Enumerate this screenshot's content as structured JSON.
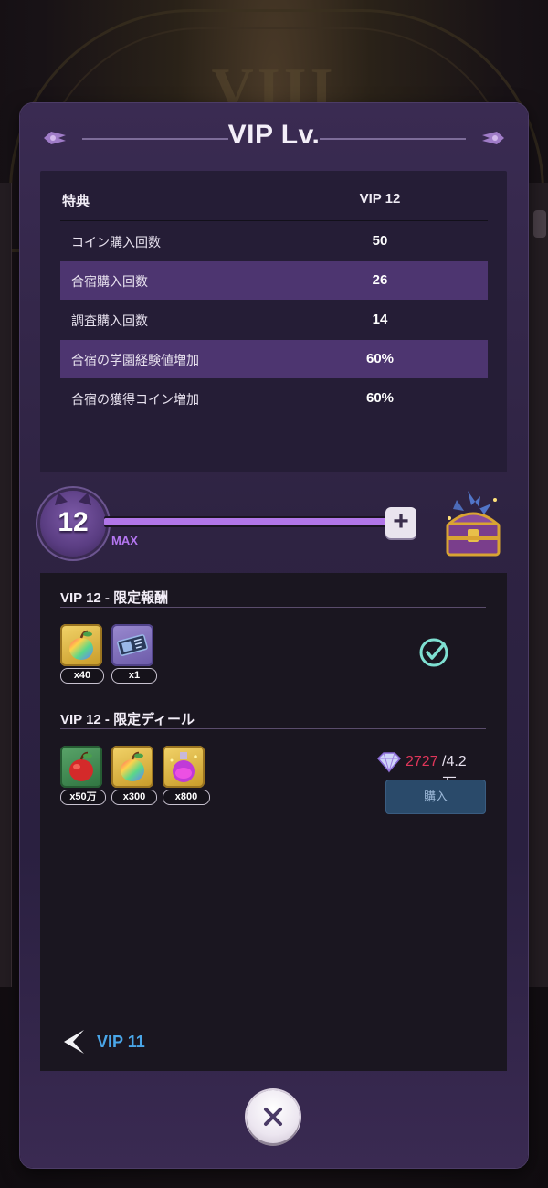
{
  "dialog": {
    "title": "VIP Lv."
  },
  "benefits_table": {
    "header_left": "特典",
    "header_right": "VIP 12",
    "rows": [
      {
        "label": "コイン購入回数",
        "value": "50"
      },
      {
        "label": "合宿購入回数",
        "value": "26"
      },
      {
        "label": "調査購入回数",
        "value": "14"
      },
      {
        "label": "合宿の学園経験値増加",
        "value": "60%"
      },
      {
        "label": "合宿の獲得コイン増加",
        "value": "60%"
      }
    ]
  },
  "level": {
    "current": "12",
    "max_label": "MAX",
    "progress": 1.0,
    "plus_label": "+",
    "chest_icon": "treasure-chest-icon"
  },
  "limited_reward": {
    "title": "VIP 12 - 限定報酬",
    "items": [
      {
        "icon": "rainbow-apple-icon",
        "qty": "x40"
      },
      {
        "icon": "ticket-icon",
        "qty": "x1"
      }
    ],
    "claimed_icon": "check-circle-icon"
  },
  "limited_deal": {
    "title": "VIP 12 - 限定ディール",
    "items": [
      {
        "icon": "red-apple-icon",
        "qty": "x50万"
      },
      {
        "icon": "rainbow-apple-icon",
        "qty": "x300"
      },
      {
        "icon": "rainbow-potion-icon",
        "qty": "x800"
      }
    ],
    "price_current": "2727",
    "price_required": "/4.2万",
    "currency_icon": "diamond-icon",
    "buy_label": "購入"
  },
  "navigation": {
    "prev_label": "VIP 11"
  },
  "close_icon": "close-icon",
  "colors": {
    "panel": "#2e2342",
    "highlight_row": "#4d3570",
    "progress": "#b176e8",
    "link": "#4aa6e8",
    "price_insufficient": "#e0365a"
  }
}
